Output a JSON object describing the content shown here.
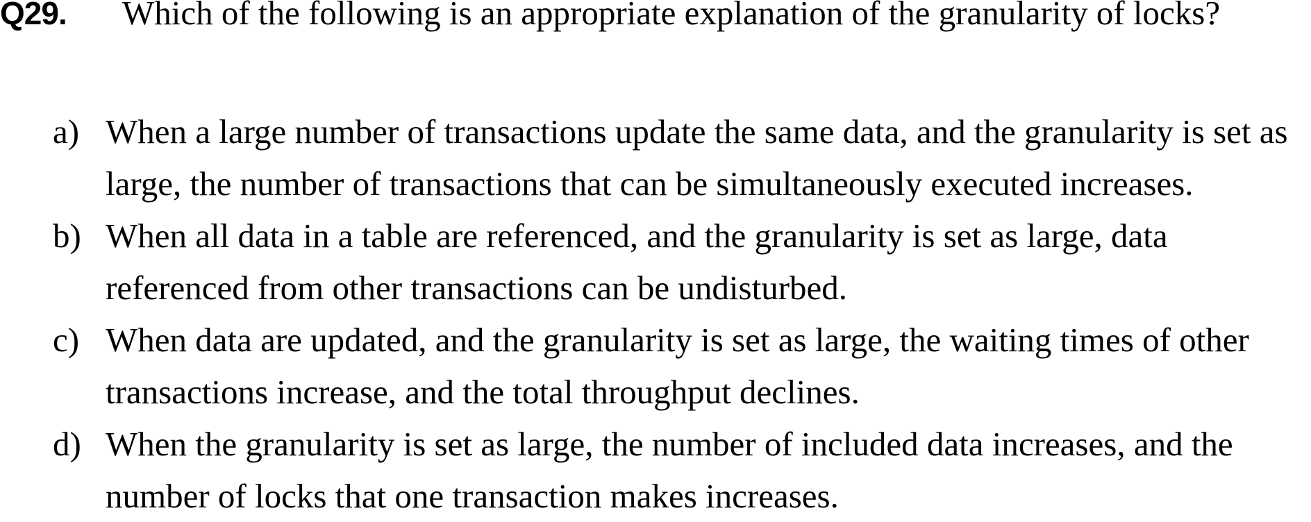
{
  "question": {
    "number": "Q29.",
    "text": "Which of the following is an appropriate explanation of the granularity of locks?"
  },
  "options": [
    {
      "letter": "a)",
      "lines": [
        "When a large number of transactions update the same data, and the granularity is set as",
        "large, the number of transactions that can be simultaneously executed increases."
      ]
    },
    {
      "letter": "b)",
      "lines": [
        "When all data in a table are referenced, and the granularity is set as large, data",
        "referenced from other transactions can be undisturbed."
      ]
    },
    {
      "letter": "c)",
      "lines": [
        "When data are updated, and the granularity is set as large, the waiting times of other",
        "transactions increase, and the total throughput declines."
      ]
    },
    {
      "letter": "d)",
      "lines": [
        "When the granularity is set as large, the number of included data increases, and the",
        "number of locks that one transaction makes increases."
      ]
    }
  ]
}
